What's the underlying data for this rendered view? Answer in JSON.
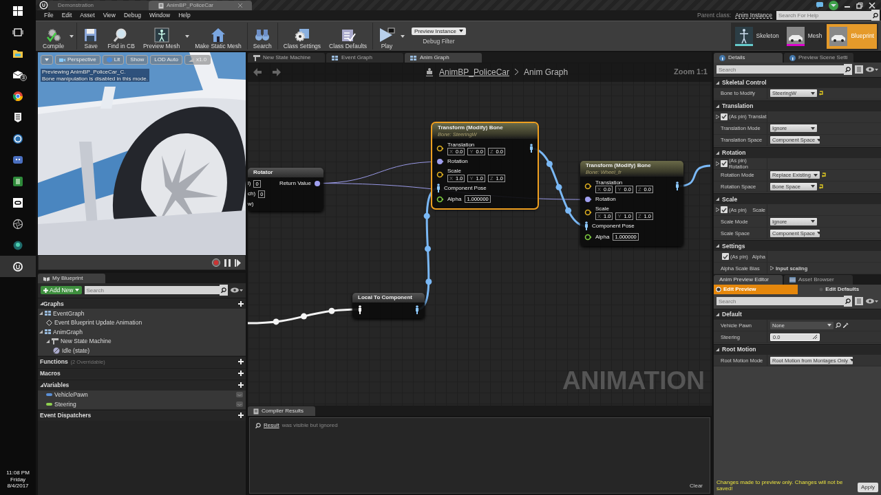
{
  "taskbar": {
    "mail_badge": "3",
    "clock": {
      "time": "11:08 PM",
      "day": "Friday",
      "date": "8/4/2017"
    }
  },
  "window": {
    "tabs": [
      {
        "label": "Demonstration",
        "selected": false
      },
      {
        "label": "AnimBP_PoliceCar",
        "selected": true
      }
    ]
  },
  "menu": [
    "File",
    "Edit",
    "Asset",
    "View",
    "Debug",
    "Window",
    "Help"
  ],
  "parent_class": {
    "label": "Parent class:",
    "value": "Anim Instance"
  },
  "help_search": {
    "placeholder": "Search For Help"
  },
  "toolbar": [
    {
      "label": "Compile",
      "has_menu": true
    },
    {
      "label": "Save",
      "has_menu": false
    },
    {
      "label": "Find in CB",
      "has_menu": false
    },
    {
      "label": "Preview Mesh",
      "has_menu": true
    },
    {
      "label": "Make Static Mesh",
      "has_menu": false
    },
    {
      "label": "Search",
      "has_menu": false
    },
    {
      "label": "Class Settings",
      "has_menu": false
    },
    {
      "label": "Class Defaults",
      "has_menu": false
    },
    {
      "label": "Play",
      "has_menu": true
    }
  ],
  "debug_filter": {
    "value": "Preview Instance",
    "label": "Debug Filter"
  },
  "modes": [
    {
      "label": "Skeleton",
      "selected": false
    },
    {
      "label": "Mesh",
      "selected": false
    },
    {
      "label": "Blueprint",
      "selected": true
    }
  ],
  "viewport": {
    "buttons": [
      "Perspective",
      "Lit",
      "Show",
      "LOD Auto",
      "x1.0"
    ],
    "overlay": [
      "Previewing AnimBP_PoliceCar_C.",
      "Bone manipulation is disabled in this mode."
    ]
  },
  "my_blueprint": {
    "tab": "My Blueprint",
    "add_new": "Add New",
    "search_placeholder": "Search",
    "sections": [
      {
        "label": "Graphs",
        "children": [
          {
            "label": "EventGraph",
            "children": [
              {
                "label": "Event Blueprint Update Animation"
              }
            ]
          },
          {
            "label": "AnimGraph",
            "children": [
              {
                "label": "New State Machine",
                "children": [
                  {
                    "label": "Idle (state)"
                  }
                ]
              }
            ]
          }
        ]
      },
      {
        "label": "Functions",
        "note": "(2 Overridable)"
      },
      {
        "label": "Macros"
      },
      {
        "label": "Variables",
        "children": [
          {
            "label": "VehiclePawn",
            "color": "#5b8fd6"
          },
          {
            "label": "Steering",
            "color": "#8fd14f"
          }
        ]
      },
      {
        "label": "Event Dispatchers"
      }
    ]
  },
  "graph_tabs": [
    {
      "label": "New State Machine",
      "selected": false
    },
    {
      "label": "Event Graph",
      "selected": false
    },
    {
      "label": "Anim Graph",
      "selected": true
    }
  ],
  "breadcrumb": [
    "AnimBP_PoliceCar",
    "Anim Graph"
  ],
  "zoom": "Zoom 1:1",
  "watermark": "ANIMATION",
  "nodes": [
    {
      "kind": "rotator",
      "title": "Rotator",
      "inputs": [
        {
          "label": "l)",
          "value": "0"
        },
        {
          "label": "ch)",
          "value": "0"
        },
        {
          "label": "w)"
        }
      ],
      "output": "Return Value"
    },
    {
      "kind": "transform",
      "title": "Transform (Modify) Bone",
      "subtitle": "Bone: SteeringW",
      "selected": true,
      "pins": [
        {
          "kind": "vector",
          "label": "Translation",
          "values": [
            {
              "axis": "X",
              "value": "0.0"
            },
            {
              "axis": "Y",
              "value": "0.0"
            },
            {
              "axis": "Z",
              "value": "0.0"
            }
          ]
        },
        {
          "kind": "rotator",
          "label": "Rotation"
        },
        {
          "kind": "vector",
          "label": "Scale",
          "values": [
            {
              "axis": "X",
              "value": "1.0"
            },
            {
              "axis": "Y",
              "value": "1.0"
            },
            {
              "axis": "Z",
              "value": "1.0"
            }
          ]
        },
        {
          "kind": "pose",
          "label": "Component Pose"
        },
        {
          "kind": "float",
          "label": "Alpha",
          "value": "1.000000"
        }
      ]
    },
    {
      "kind": "transform",
      "title": "Transform (Modify) Bone",
      "subtitle": "Bone: Wheel_fr",
      "selected": false,
      "pins": [
        {
          "kind": "vector",
          "label": "Translation",
          "values": [
            {
              "axis": "X",
              "value": "0.0"
            },
            {
              "axis": "Y",
              "value": "0.0"
            },
            {
              "axis": "Z",
              "value": "0.0"
            }
          ]
        },
        {
          "kind": "rotator",
          "label": "Rotation"
        },
        {
          "kind": "vector",
          "label": "Scale",
          "values": [
            {
              "axis": "X",
              "value": "1.0"
            },
            {
              "axis": "Y",
              "value": "1.0"
            },
            {
              "axis": "Z",
              "value": "1.0"
            }
          ]
        },
        {
          "kind": "pose",
          "label": "Component Pose"
        },
        {
          "kind": "float",
          "label": "Alpha",
          "value": "1.000000"
        }
      ]
    },
    {
      "kind": "convert",
      "title": "Local To Component"
    }
  ],
  "compiler": {
    "tab": "Compiler Results",
    "rows": [
      {
        "link": "Result",
        "message": "was visible but ignored"
      }
    ],
    "clear": "Clear"
  },
  "details": {
    "tabs": [
      {
        "label": "Details",
        "selected": true
      },
      {
        "label": "Preview Scene Setti",
        "selected": false
      }
    ],
    "search_placeholder": "Search",
    "sections": [
      {
        "label": "Skeletal Control",
        "rows": [
          {
            "kind": "combo",
            "label": "Bone to Modify",
            "value": "SteeringW",
            "reset": true
          }
        ]
      },
      {
        "label": "Translation",
        "rows": [
          {
            "kind": "pin",
            "label": "(As pin) Translat",
            "checked": true,
            "expanded": false
          },
          {
            "kind": "combo",
            "label": "Translation Mode",
            "value": "Ignore",
            "reset": false
          },
          {
            "kind": "combo",
            "label": "Translation Space",
            "value": "Component Space",
            "reset": false
          }
        ]
      },
      {
        "label": "Rotation",
        "rows": [
          {
            "kind": "pin",
            "label": "(As pin) Rotation",
            "checked": true,
            "expanded": false
          },
          {
            "kind": "combo",
            "label": "Rotation Mode",
            "value": "Replace Existing",
            "reset": true
          },
          {
            "kind": "combo",
            "label": "Rotation Space",
            "value": "Bone Space",
            "reset": true
          }
        ]
      },
      {
        "label": "Scale",
        "rows": [
          {
            "kind": "pin",
            "label": "(As pin)",
            "name": "Scale",
            "checked": true,
            "expanded": false
          },
          {
            "kind": "combo",
            "label": "Scale Mode",
            "value": "Ignore",
            "reset": false
          },
          {
            "kind": "combo",
            "label": "Scale Space",
            "value": "Component Space",
            "reset": false
          }
        ]
      },
      {
        "label": "Settings",
        "rows": [
          {
            "kind": "pin",
            "label": "(As pin)",
            "name": "Alpha",
            "checked": true
          },
          {
            "kind": "struct",
            "label": "Alpha Scale Bias",
            "value": "Input scaling"
          }
        ]
      }
    ]
  },
  "preview_editor": {
    "tabs": [
      {
        "label": "Anim Preview Editor",
        "selected": true
      },
      {
        "label": "Asset Browser",
        "selected": false
      }
    ],
    "modes": [
      {
        "label": "Edit Preview",
        "selected": true
      },
      {
        "label": "Edit Defaults",
        "selected": false
      }
    ],
    "search_placeholder": "Search",
    "sections": [
      {
        "label": "Default",
        "rows": [
          {
            "kind": "object",
            "label": "Vehicle Pawn",
            "value": "None"
          },
          {
            "kind": "number",
            "label": "Steering",
            "value": "0.0"
          }
        ]
      },
      {
        "label": "Root Motion",
        "rows": [
          {
            "kind": "combo",
            "label": "Root Motion Mode",
            "value": "Root Motion from Montages Only",
            "reset": false
          }
        ]
      }
    ],
    "notice": "Changes made to preview only. Changes will not be saved!",
    "apply": "Apply"
  }
}
